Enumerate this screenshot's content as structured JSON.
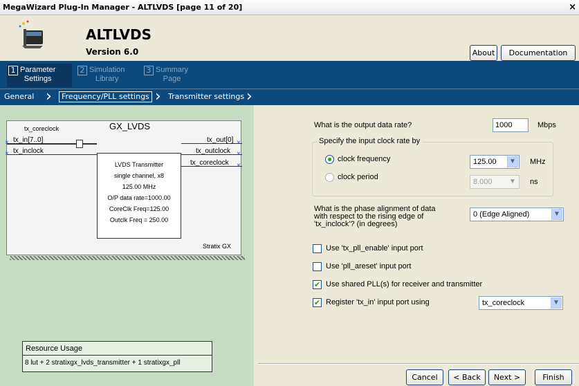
{
  "window": {
    "title": "MegaWizard Plug-In Manager - ALTLVDS [page 11 of 20]",
    "close_glyph": "×"
  },
  "header": {
    "name": "ALTLVDS",
    "version": "Version 6.0",
    "about": "About",
    "documentation": "Documentation"
  },
  "steps": [
    {
      "num": "1",
      "label_line1": "Parameter",
      "label_line2": "Settings"
    },
    {
      "num": "2",
      "label_line1": "Simulation",
      "label_line2": "Library"
    },
    {
      "num": "3",
      "label_line1": "Summary",
      "label_line2": "Page"
    }
  ],
  "breadcrumbs": [
    "General",
    "Frequency/PLL settings",
    "Transmitter settings"
  ],
  "diagram": {
    "title": "GX_LVDS",
    "port_tx_coreclock_top": "tx_coreclock",
    "port_tx_in": "tx_in[7..0]",
    "port_tx_inclock": "tx_inclock",
    "port_tx_out": "tx_out[0]",
    "port_tx_outclock": "tx_outclock",
    "port_tx_coreclock_out": "tx_coreclock",
    "block_lines": [
      "LVDS Transmitter",
      "single channel, x8",
      "125.00 MHz",
      "O/P data rate=1000.00",
      "CoreClk Freq=125.00",
      "Outclk Freq = 250.00"
    ],
    "device": "Stratix GX"
  },
  "resource": {
    "header": "Resource Usage",
    "value": "8 lut + 2 stratixgx_lvds_transmitter + 1 stratixgx_pll"
  },
  "form": {
    "output_rate_label": "What is the output data rate?",
    "output_rate_value": "1000",
    "output_rate_unit": "Mbps",
    "clock_group_label": "Specify the input clock rate by",
    "clock_frequency_label": "clock frequency",
    "clock_frequency_value": "125.00",
    "clock_frequency_unit": "MHz",
    "clock_period_label": "clock period",
    "clock_period_value": "8.000",
    "clock_period_unit": "ns",
    "phase_label_1": "What is the phase alignment of data",
    "phase_label_2": "with respect to the rising edge of",
    "phase_label_3": "'tx_inclock'? (in degrees)",
    "phase_value": "0 (Edge Aligned)",
    "chk_pll_enable": "Use 'tx_pll_enable' input port",
    "chk_pll_areset": "Use 'pll_areset' input port",
    "chk_shared_pll": "Use shared PLL(s) for receiver and transmitter",
    "chk_register": "Register 'tx_in' input port using",
    "register_value": "tx_coreclock"
  },
  "footer": {
    "cancel": "Cancel",
    "back": "< Back",
    "next": "Next >",
    "finish": "Finish"
  }
}
